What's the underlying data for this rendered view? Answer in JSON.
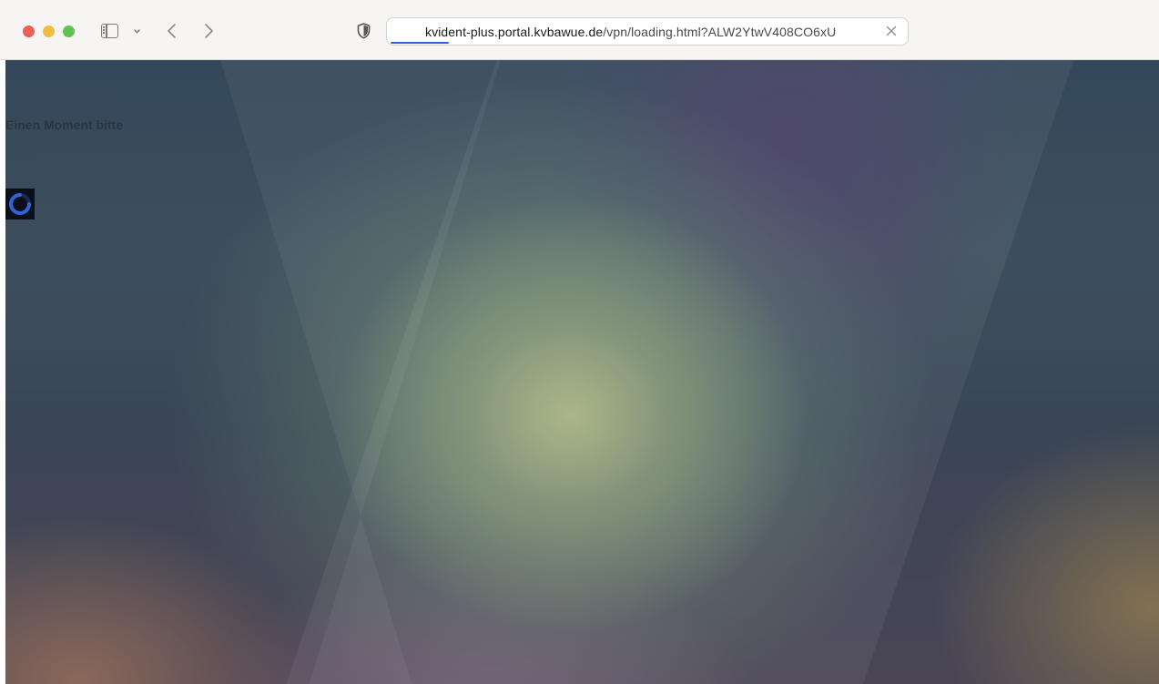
{
  "browser": {
    "url_host": "kvident-plus.portal.kvbawue.de",
    "url_path": "/vpn/loading.html?ALW2YtwV408CO6xU",
    "icons": [
      "sidebar-icon",
      "chevron-down-icon",
      "back-arrow-icon",
      "forward-arrow-icon",
      "shield-icon",
      "clear-icon"
    ],
    "traffic_light_colors": [
      "#ee5f56",
      "#f3bd40",
      "#5fc451"
    ],
    "progress_color": "#2f64d6"
  },
  "page": {
    "heading": "Einen Moment bitte",
    "status": "Laden...",
    "spinner_colors": {
      "ring": "#2f64d6",
      "background": "#0b0f18"
    }
  }
}
